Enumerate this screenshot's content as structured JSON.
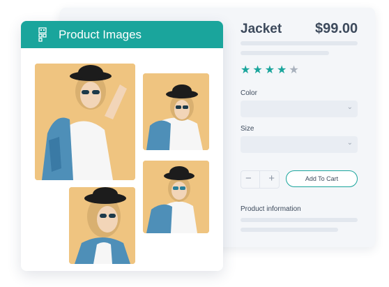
{
  "product": {
    "title": "Jacket",
    "price": "$99.00",
    "rating": 4,
    "rating_max": 5
  },
  "options": {
    "color_label": "Color",
    "size_label": "Size"
  },
  "cart": {
    "add_label": "Add To Cart",
    "minus": "−",
    "plus": "+"
  },
  "info": {
    "label": "Product information"
  },
  "images_panel": {
    "title": "Product Images"
  },
  "colors": {
    "accent": "#1aa59c",
    "text": "#3d4a5c",
    "skeleton": "#e2e7ee",
    "photo_bg": "#efc480"
  }
}
